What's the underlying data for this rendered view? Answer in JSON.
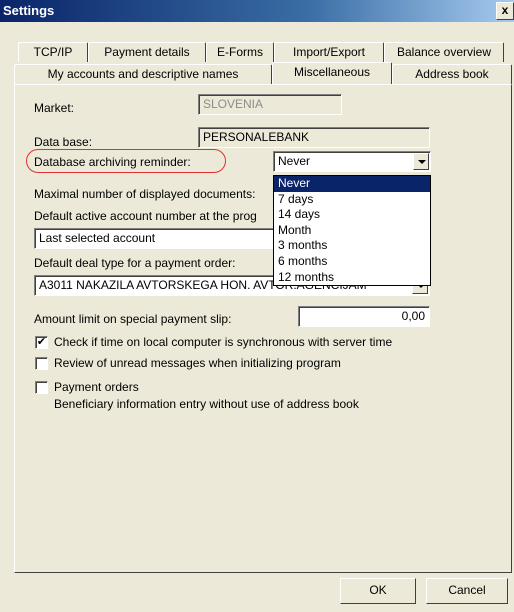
{
  "window": {
    "title": "Settings",
    "close_glyph": "x"
  },
  "tabs": {
    "row1": [
      "TCP/IP",
      "Payment details",
      "E-Forms",
      "Import/Export",
      "Balance overview"
    ],
    "row2": [
      "My accounts and descriptive names",
      "Miscellaneous",
      "Address book"
    ],
    "active": "Miscellaneous"
  },
  "form": {
    "market_label": "Market:",
    "market_value": "SLOVENIA",
    "database_label": "Data base:",
    "database_value": "PERSONALEBANK",
    "archiving_label": "Database archiving reminder:",
    "archiving_value": "Never",
    "archiving_options": [
      "Never",
      "7 days",
      "14 days",
      "Month",
      "3 months",
      "6 months",
      "12 months"
    ],
    "max_docs_label": "Maximal number of displayed documents:",
    "default_account_label": "Default active account number at the prog",
    "default_account_value": "Last selected account",
    "deal_type_label": "Default deal type for a payment order:",
    "deal_type_value": "A3011 NAKAZILA AVTORSKEGA HON. AVTOR.AGENCIJAM",
    "amount_limit_label": "Amount limit on special payment slip:",
    "amount_limit_value": "0,00",
    "check_time_label": "Check if time on local computer is synchronous with server time",
    "check_time_checked": "✔",
    "review_label": "Review of unread messages when initializing program",
    "payment_orders_label": "Payment orders",
    "beneficiary_label": "Beneficiary information entry without use of address book"
  },
  "buttons": {
    "ok": "OK",
    "cancel": "Cancel"
  },
  "colors": {
    "highlight_ring": "#e03030",
    "selection": "#0a246a"
  }
}
